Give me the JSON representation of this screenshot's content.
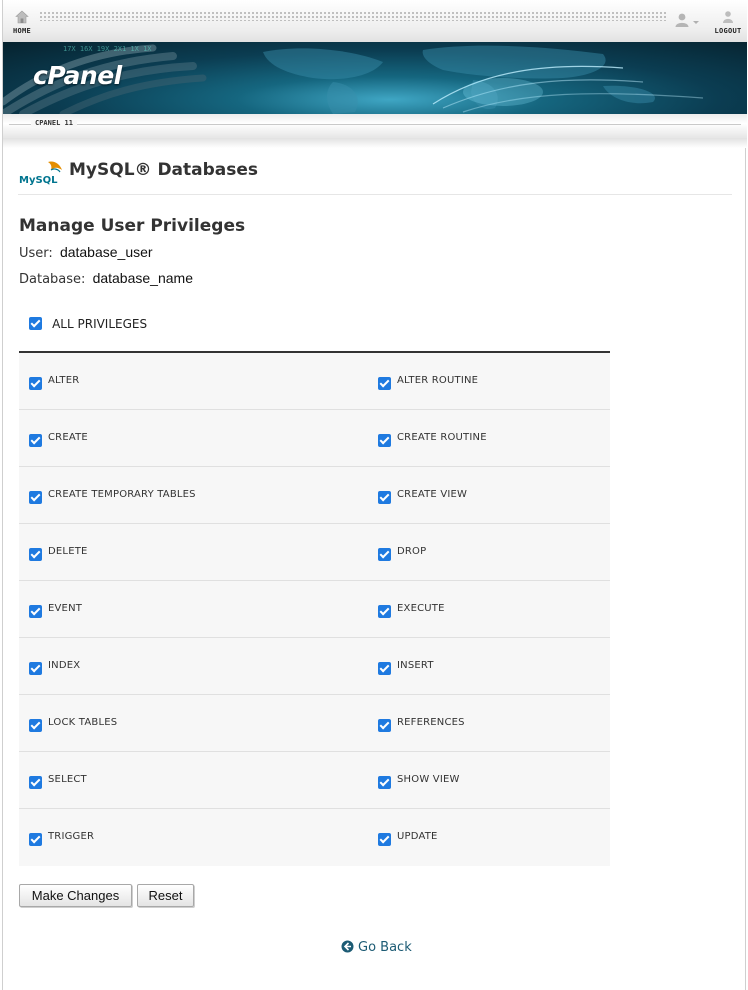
{
  "topbar": {
    "home_label": "HOME",
    "logout_label": "LOGOUT"
  },
  "banner": {
    "logo_text": "cPanel",
    "version_label": "CPANEL 11"
  },
  "header": {
    "mysql_logo_text": "MySQL",
    "title": "MySQL® Databases"
  },
  "section": {
    "title": "Manage User Privileges",
    "user_label": "User:",
    "user_value": "database_user",
    "database_label": "Database:",
    "database_value": "database_name"
  },
  "all_privileges": {
    "label": "ALL PRIVILEGES",
    "checked": true
  },
  "privileges": [
    {
      "left": "ALTER",
      "right": "ALTER ROUTINE"
    },
    {
      "left": "CREATE",
      "right": "CREATE ROUTINE"
    },
    {
      "left": "CREATE TEMPORARY TABLES",
      "right": "CREATE VIEW"
    },
    {
      "left": "DELETE",
      "right": "DROP"
    },
    {
      "left": "EVENT",
      "right": "EXECUTE"
    },
    {
      "left": "INDEX",
      "right": "INSERT"
    },
    {
      "left": "LOCK TABLES",
      "right": "REFERENCES"
    },
    {
      "left": "SELECT",
      "right": "SHOW VIEW"
    },
    {
      "left": "TRIGGER",
      "right": "UPDATE"
    }
  ],
  "buttons": {
    "make_changes": "Make Changes",
    "reset": "Reset"
  },
  "go_back": "Go Back",
  "colors": {
    "checkbox": "#1f7ae0",
    "link": "#1c5b74",
    "banner": "#0b3d52"
  }
}
